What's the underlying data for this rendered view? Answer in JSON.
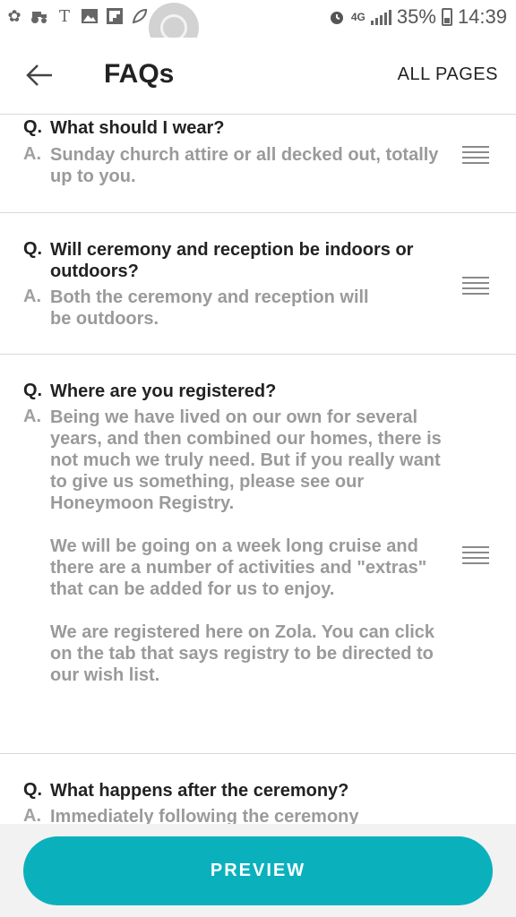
{
  "status_bar": {
    "net_type": "4G",
    "battery_percent": "35%",
    "time": "14:39",
    "icons": [
      "pinwheel-icon",
      "tractor-icon",
      "t-icon",
      "image-icon",
      "flipboard-icon",
      "leaf-icon",
      "alarm-icon",
      "signal-icon",
      "battery-icon"
    ]
  },
  "header": {
    "back_icon": "arrow-left-icon",
    "title": "FAQs",
    "all_pages": "ALL PAGES"
  },
  "faqs": [
    {
      "q_prefix": "Q.",
      "question": "What should I wear?",
      "a_prefix": "A.",
      "answer": "Sunday church attire or all decked out, totally up to you."
    },
    {
      "q_prefix": "Q.",
      "question": "Will ceremony and reception be indoors or outdoors?",
      "a_prefix": "A.",
      "answer": "Both the ceremony and reception will be outdoors."
    },
    {
      "q_prefix": "Q.",
      "question": "Where are you registered?",
      "a_prefix": "A.",
      "answer": "Being we have lived on our own for several years,  and then combined our homes, there is not much we truly need. But if you really want to give us something, please see our Honeymoon Registry.\n\n We will be going on a week long cruise and there are a number of activities and \"extras\" that can be added for us to enjoy.\n\nWe are registered here on Zola. You can click on the tab that says registry to be directed to our wish list."
    },
    {
      "q_prefix": "Q.",
      "question": "What happens after the ceremony?",
      "a_prefix": "A.",
      "answer": "Immediately following the ceremony"
    }
  ],
  "footer": {
    "preview_label": "PREVIEW"
  },
  "colors": {
    "accent": "#0ab1bd",
    "answer_text": "#9a9a9a",
    "divider": "#d9d9d9"
  }
}
